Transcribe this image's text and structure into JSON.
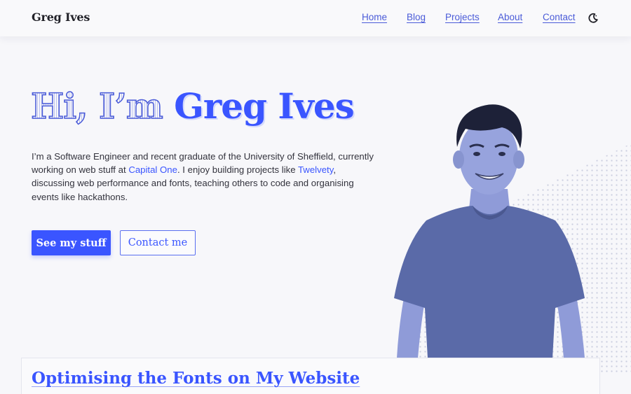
{
  "header": {
    "brand": "Greg Ives",
    "nav": [
      "Home",
      "Blog",
      "Projects",
      "About",
      "Contact"
    ],
    "theme_toggle_icon": "moon-icon"
  },
  "hero": {
    "greeting": "Hi, I’m ",
    "name": "Greg Ives",
    "intro": {
      "part1": "I’m a Software Engineer and recent graduate of the University of Sheffield, currently working on web stuff at ",
      "link1": "Capital One",
      "part2": ". I enjoy building projects like ",
      "link2": "Twelvety",
      "part3": ", discussing web performance and fonts, teaching others to code and organising events like hackathons."
    },
    "primary_button": "See my stuff",
    "secondary_button": "Contact me"
  },
  "featured_post": {
    "title": "Optimising the Fonts on My Website"
  },
  "colors": {
    "accent": "#3a55ff",
    "nav_link": "#4a5bd8",
    "background": "#f7f7fa",
    "portrait_tint": "#5b6aa8"
  }
}
